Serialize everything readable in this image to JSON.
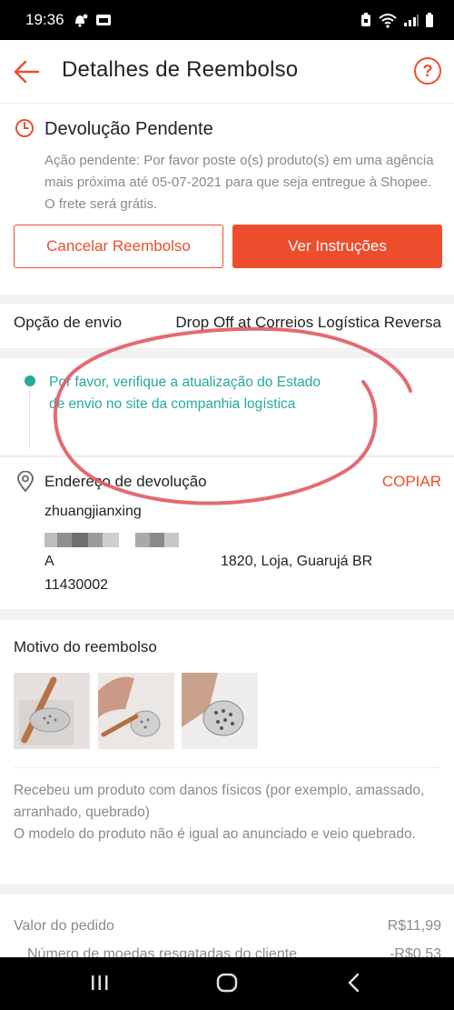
{
  "status_bar": {
    "time": "19:36"
  },
  "header": {
    "title": "Detalhes de Reembolso",
    "help_label": "?"
  },
  "status": {
    "title": "Devolução Pendente",
    "description": "Ação pendente: Por favor poste o(s) produto(s) em uma agência mais próxima até 05-07-2021 para que seja entregue à Shopee. O frete será grátis.",
    "cancel_button": "Cancelar Reembolso",
    "instructions_button": "Ver Instruções"
  },
  "shipping": {
    "label": "Opção de envio",
    "value": "Drop Off at Correios Logística Reversa"
  },
  "tracking": {
    "message": "Por favor, verifique a atualização do Estado de envio no site da companhia logística"
  },
  "address": {
    "title": "Endereço de devolução",
    "copy_label": "COPIAR",
    "name": "zhuangjianxing",
    "line1_start": "A",
    "line1_end": "1820, Loja, Guarujá BR",
    "zip": "11430002"
  },
  "reason": {
    "title": "Motivo do reembolso",
    "text_line1": "Recebeu um produto com danos físicos (por exemplo, amassado, arranhado, quebrado)",
    "text_line2": "O modelo do produto não é igual ao anunciado e veio quebrado."
  },
  "order": {
    "value_label": "Valor do pedido",
    "value": "R$11,99",
    "coins_label": "Número de moedas resgatadas do cliente",
    "coins_value": "-R$0,53"
  },
  "colors": {
    "accent": "#ee4d2d",
    "teal": "#26aa99",
    "annotation": "#e05a63"
  }
}
